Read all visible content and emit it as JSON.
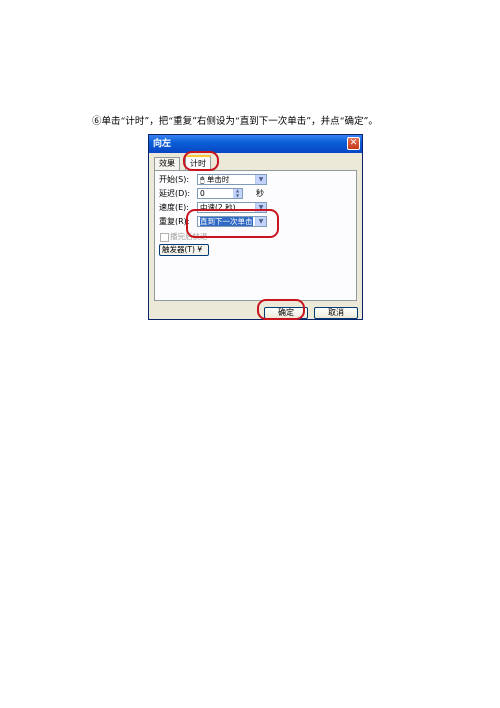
{
  "instruction": "⑥单击“计时”，把“重复”右侧设为“直到下一次单击”，并点“确定”。",
  "dialog": {
    "title": "向左",
    "close_glyph": "✕",
    "tabs": {
      "effect": "效果",
      "timing": "计时"
    },
    "fields": {
      "start_label": "开始(S):",
      "start_value": "单击时",
      "delay_label": "延迟(D):",
      "delay_value": "0",
      "delay_unit": "秒",
      "speed_label": "速度(E):",
      "speed_value": "中速(2 秒)",
      "repeat_label": "重复(R):",
      "repeat_value": "直到下一次单击",
      "rewind_label": "播完后快退"
    },
    "trigger_label": "触发器(T) ¥",
    "buttons": {
      "ok": "确定",
      "cancel": "取消"
    }
  },
  "highlight_color": "#c8141e"
}
